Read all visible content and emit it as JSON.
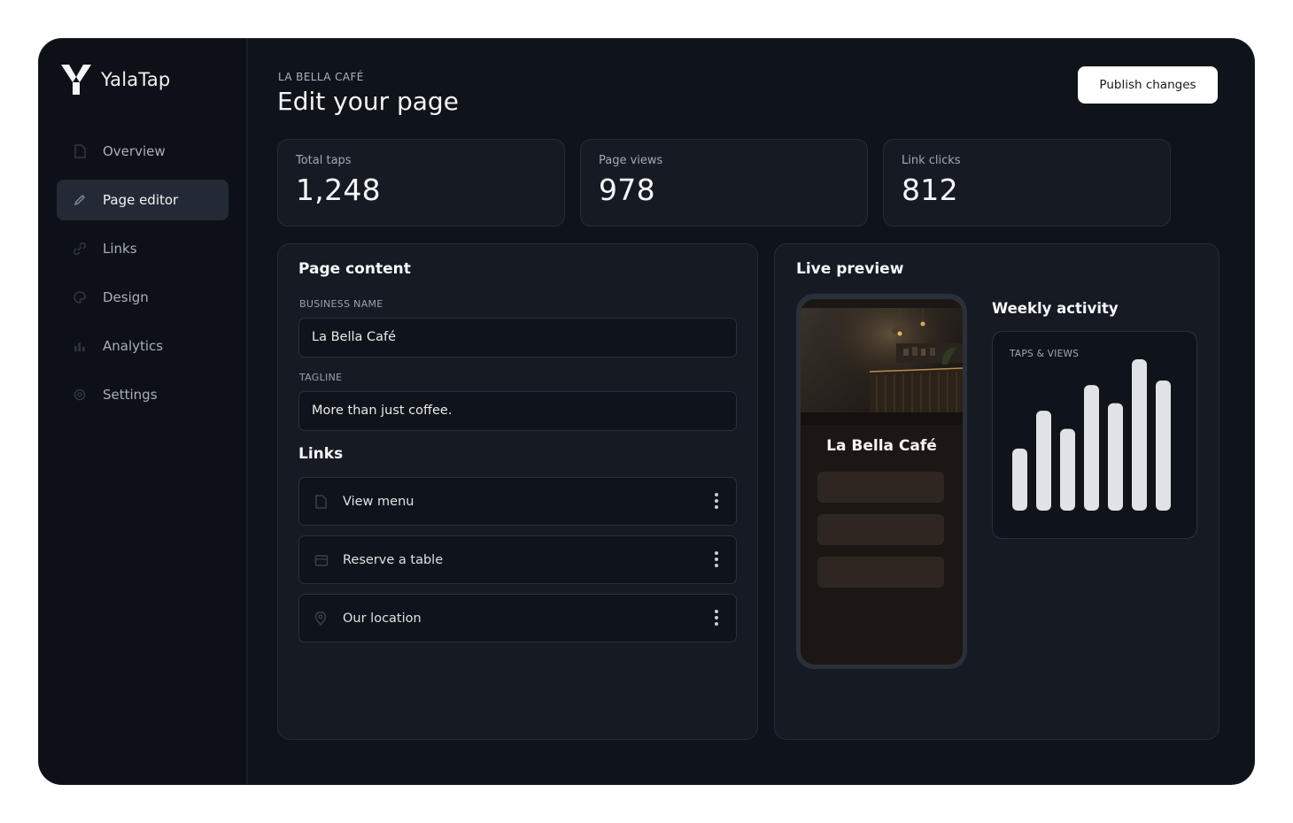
{
  "brand": {
    "name": "YalaTap"
  },
  "sidebar": {
    "items": [
      {
        "label": "Overview",
        "icon": "document-icon"
      },
      {
        "label": "Page editor",
        "icon": "pencil-icon",
        "active": true
      },
      {
        "label": "Links",
        "icon": "link-icon"
      },
      {
        "label": "Design",
        "icon": "palette-icon"
      },
      {
        "label": "Analytics",
        "icon": "bar-chart-icon"
      },
      {
        "label": "Settings",
        "icon": "gear-icon"
      }
    ]
  },
  "header": {
    "eyebrow": "LA BELLA CAFÉ",
    "title": "Edit your page",
    "publish_label": "Publish changes"
  },
  "stats": [
    {
      "label": "Total taps",
      "value": "1,248"
    },
    {
      "label": "Page views",
      "value": "978"
    },
    {
      "label": "Link clicks",
      "value": "812"
    }
  ],
  "content": {
    "title": "Page content",
    "business_name_label": "BUSINESS NAME",
    "business_name": "La Bella Café",
    "tagline_label": "TAGLINE",
    "tagline": "More than just coffee.",
    "links_title": "Links",
    "links": [
      {
        "label": "View menu",
        "icon": "document-icon"
      },
      {
        "label": "Reserve a table",
        "icon": "calendar-icon"
      },
      {
        "label": "Our location",
        "icon": "map-pin-icon"
      }
    ]
  },
  "preview": {
    "title": "Live preview",
    "business_name": "La Bella Café"
  },
  "weekly": {
    "title": "Weekly activity",
    "chart_label": "TAPS & VIEWS"
  },
  "chart_data": {
    "type": "bar",
    "title": "TAPS & VIEWS",
    "values": [
      0.41,
      0.66,
      0.54,
      0.83,
      0.71,
      1.0,
      0.86
    ],
    "color": "#dfe2e7"
  },
  "colors": {
    "background": "#0f131a",
    "sidebar": "#0d1117",
    "panel": "#161b23",
    "accent_button": "#ffffff"
  }
}
